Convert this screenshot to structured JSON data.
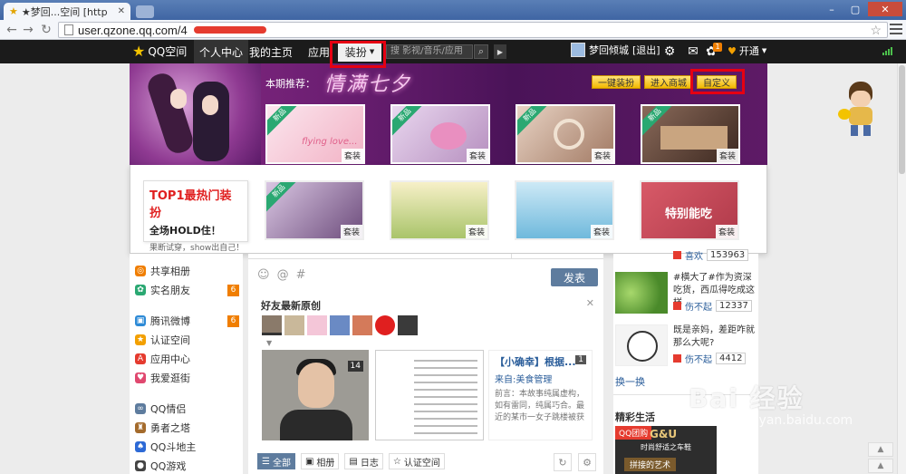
{
  "browser": {
    "tab_title": "★梦回...空间 [http",
    "url": "user.qzone.qq.com/4"
  },
  "nav": {
    "logo": "QQ空间",
    "items": [
      "个人中心",
      "我的主页",
      "应用"
    ],
    "dress_label": "装扮",
    "search_placeholder": "搜 影视/音乐/应用",
    "user_name": "梦回倾城",
    "logout": "[退出]",
    "notif_count": "1",
    "open_label": "开通"
  },
  "banner": {
    "recommend_label": "本期推荐：",
    "title": "情满七夕",
    "btn_one_click": "一键装扮",
    "btn_mall": "进入商城",
    "btn_custom": "自定义",
    "tag_new": "新品",
    "thumbs": [
      {
        "tag": "套装",
        "color": "#f6d6e0",
        "caption": "flying love..."
      },
      {
        "tag": "套装",
        "color": "#d8b8dc"
      },
      {
        "tag": "套装",
        "color": "#c9a58e"
      },
      {
        "tag": "套装",
        "color": "#6c4c3c"
      }
    ]
  },
  "panel": {
    "promo_l1": "TOP1最热门装扮",
    "promo_l2": "全场HOLD住！",
    "promo_l3": "果断试穿，show出自己！",
    "thumbs": [
      {
        "tag": "套装",
        "color": "#b7a2c4"
      },
      {
        "tag": "套装",
        "color": "#c7d48a"
      },
      {
        "tag": "套装",
        "color": "#9fd1e6"
      },
      {
        "tag": "套装",
        "color": "#c54a5a",
        "caption": "特别能吃"
      }
    ]
  },
  "leftcol": {
    "items": [
      {
        "label": "共享相册",
        "color": "#f07e00",
        "icon": "share-album-icon"
      },
      {
        "label": "实名朋友",
        "color": "#2aa872",
        "icon": "realname-icon",
        "count": "6"
      },
      {
        "label": "腾讯微博",
        "color": "#2d8ad6",
        "icon": "weibo-icon",
        "count": "6"
      },
      {
        "label": "认证空间",
        "color": "#f3a000",
        "icon": "verified-icon"
      },
      {
        "label": "应用中心",
        "color": "#e53b2f",
        "icon": "app-center-icon"
      },
      {
        "label": "我爱逛街",
        "color": "#e0486f",
        "icon": "shopping-icon"
      },
      {
        "label": "QQ情侣",
        "color": "#5e7c9e",
        "icon": "couple-icon"
      },
      {
        "label": "勇者之塔",
        "color": "#a46b2c",
        "icon": "tower-icon"
      },
      {
        "label": "QQ斗地主",
        "color": "#2d6ad6",
        "icon": "poker-icon"
      },
      {
        "label": "QQ游戏",
        "color": "#444",
        "icon": "game-icon"
      }
    ]
  },
  "center": {
    "publish": "发表",
    "friends_title": "好友最新原创",
    "photo_count": "14",
    "article_title": "【小确幸】根据...",
    "article_source": "来自:美食管理",
    "article_body": "前言：本故事纯属虚构，如有雷同，纯属巧合。最近的某市一女子跳楼被获",
    "article_count": "1",
    "filters": [
      "全部",
      "相册",
      "日志",
      "认证空间"
    ]
  },
  "rightcol": {
    "items": [
      {
        "text": "",
        "user": "喜欢",
        "count": "153963"
      },
      {
        "text": "#横大了#作为资深吃货，西瓜得吃成这样",
        "user": "伤不起",
        "count": "12337"
      },
      {
        "text": "既是亲妈，差距咋就那么大呢?",
        "user": "伤不起",
        "count": "4412"
      }
    ],
    "swap": "换一换",
    "life": "精彩生活",
    "ad_qq": "QQ团购",
    "ad_brand": "G&U",
    "ad_sub": "时尚舒适之车鞋",
    "ad_bottom": "拼接的艺术"
  },
  "watermark": {
    "logo": "Bai 经验",
    "url": "jingyan.baidu.com"
  }
}
